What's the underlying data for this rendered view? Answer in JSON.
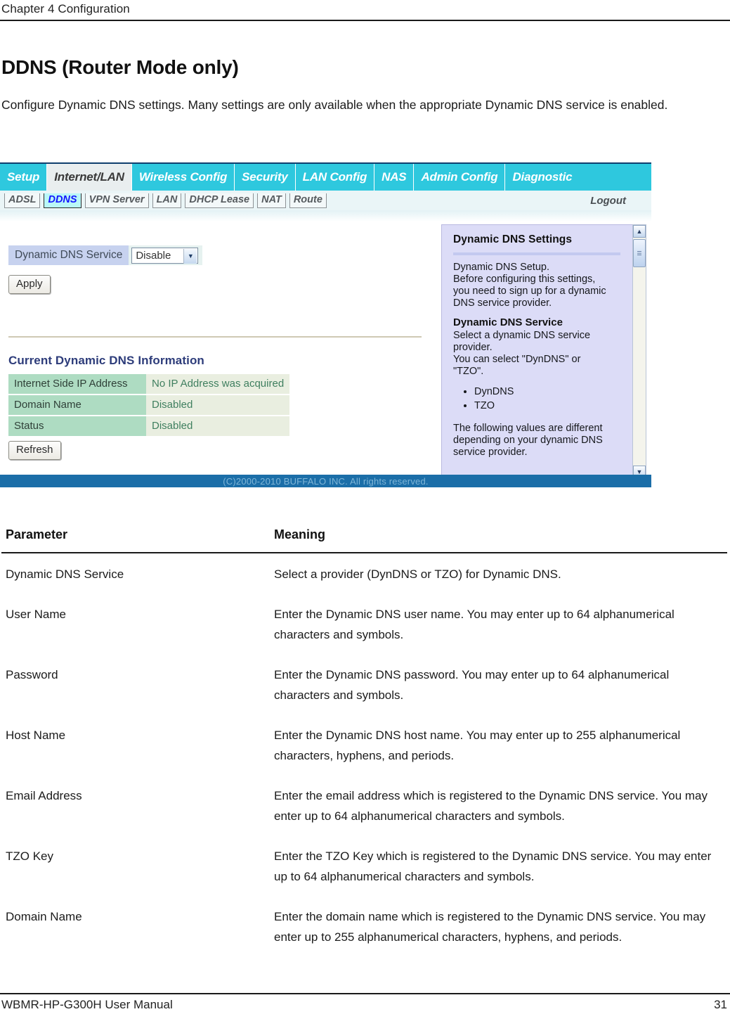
{
  "page": {
    "running_head": "Chapter 4  Configuration",
    "section_title": "DDNS (Router Mode only)",
    "intro": "Configure Dynamic DNS settings.  Many settings are only available when the appropriate Dynamic DNS service is enabled.",
    "footer_left": "WBMR-HP-G300H User Manual",
    "footer_page": "31"
  },
  "screenshot": {
    "tabs": [
      {
        "label": "Setup",
        "selected": false
      },
      {
        "label": "Internet/LAN",
        "selected": true
      },
      {
        "label": "Wireless Config",
        "selected": false
      },
      {
        "label": "Security",
        "selected": false
      },
      {
        "label": "LAN Config",
        "selected": false
      },
      {
        "label": "NAS",
        "selected": false
      },
      {
        "label": "Admin Config",
        "selected": false
      },
      {
        "label": "Diagnostic",
        "selected": false
      }
    ],
    "subtabs": [
      {
        "label": "ADSL",
        "selected": false
      },
      {
        "label": "DDNS",
        "selected": true
      },
      {
        "label": "VPN Server",
        "selected": false
      },
      {
        "label": "LAN",
        "selected": false
      },
      {
        "label": "DHCP Lease",
        "selected": false
      },
      {
        "label": "NAT",
        "selected": false
      },
      {
        "label": "Route",
        "selected": false
      }
    ],
    "logout_label": "Logout",
    "settings": {
      "service_label": "Dynamic DNS Service",
      "service_value": "Disable",
      "apply_label": "Apply",
      "refresh_label": "Refresh"
    },
    "info": {
      "title": "Current Dynamic DNS Information",
      "rows": [
        {
          "key": "Internet Side IP Address",
          "value": "No IP Address was acquired"
        },
        {
          "key": "Domain Name",
          "value": "Disabled"
        },
        {
          "key": "Status",
          "value": "Disabled"
        }
      ]
    },
    "help": {
      "heading": "Dynamic DNS Settings",
      "intro": "Dynamic DNS Setup.\nBefore configuring this settings,\nyou need to sign up for a dynamic\nDNS service provider.",
      "subheading": "Dynamic DNS Service",
      "body": "Select a dynamic DNS service\nprovider.\nYou can select \"DynDNS\" or\n\"TZO\".",
      "bullets": [
        "DynDNS",
        "TZO"
      ],
      "closing": "The following values are different\ndepending on your dynamic DNS\nservice provider."
    },
    "copyright": "(C)2000-2010 BUFFALO INC. All rights reserved.",
    "colors": {
      "tab_accent": "#2ec8de",
      "selected_subtab_text": "#1414ff",
      "help_panel_bg": "#dcdcf7",
      "footer_bar": "#1b6ea8",
      "info_key_bg": "#aedcc2",
      "info_value_bg": "#e9eee0"
    }
  },
  "param_table": {
    "headers": {
      "parameter": "Parameter",
      "meaning": "Meaning"
    },
    "rows": [
      {
        "parameter": "Dynamic DNS Service",
        "meaning": "Select a provider (DynDNS or TZO) for Dynamic DNS."
      },
      {
        "parameter": "User Name",
        "meaning": "Enter the Dynamic DNS user name. You may enter up to 64 alphanumerical characters and symbols."
      },
      {
        "parameter": "Password",
        "meaning": "Enter the Dynamic DNS password. You may enter up to 64 alphanumerical characters and symbols."
      },
      {
        "parameter": "Host Name",
        "meaning": "Enter the Dynamic DNS host name. You may enter up to 255 alphanumerical characters, hyphens, and periods."
      },
      {
        "parameter": "Email Address",
        "meaning": "Enter the email address which is registered to the Dynamic DNS service. You may enter up to 64 alphanumerical characters and symbols."
      },
      {
        "parameter": "TZO Key",
        "meaning": "Enter the TZO Key which is registered to the Dynamic DNS service. You may enter up to 64 alphanumerical characters and symbols."
      },
      {
        "parameter": "Domain Name",
        "meaning": "Enter the domain name which is registered to the Dynamic DNS service.  You may enter up to 255 alphanumerical characters, hyphens, and periods."
      }
    ]
  }
}
